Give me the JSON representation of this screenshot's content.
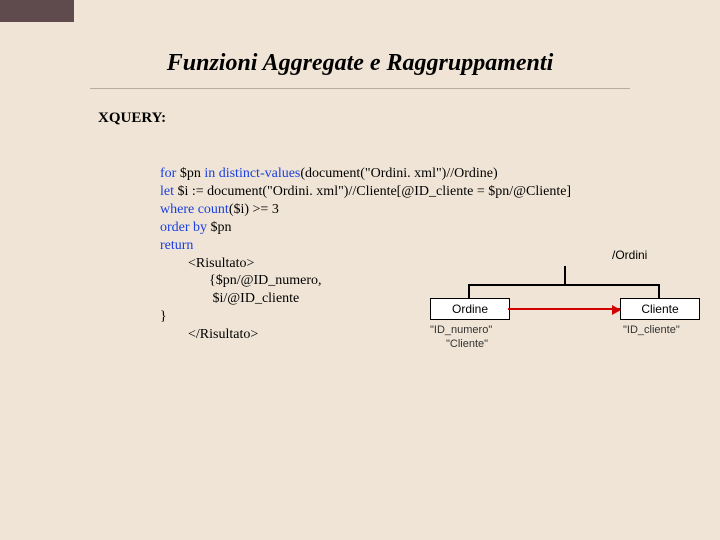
{
  "title": "Funzioni Aggregate e Raggruppamenti",
  "section_label": "XQUERY:",
  "code": {
    "kw_for": "for",
    "l1_a": " $pn ",
    "kw_in": "in ",
    "fn_distinct": "distinct-values",
    "l1_b": "(document(\"Ordini. xml\")//Ordine)",
    "kw_let": "let",
    "l2": " $i := document(\"Ordini. xml\")//Cliente[@ID_cliente = $pn/@Cliente]",
    "kw_where": "where ",
    "fn_count": "count",
    "l3": "($i) >= 3",
    "kw_order": "order by",
    "l4": " $pn",
    "kw_return": "return",
    "l6": "        <Risultato>",
    "l7": "              {$pn/@ID_numero,",
    "l8": "               $i/@ID_cliente",
    "l9": "}",
    "l10": "        </Risultato>"
  },
  "diagram": {
    "root": "/Ordini",
    "node1": "Ordine",
    "node2": "Cliente",
    "attr1a": "\"ID_numero\"",
    "attr1b": "\"Cliente\"",
    "attr2": "\"ID_cliente\""
  }
}
